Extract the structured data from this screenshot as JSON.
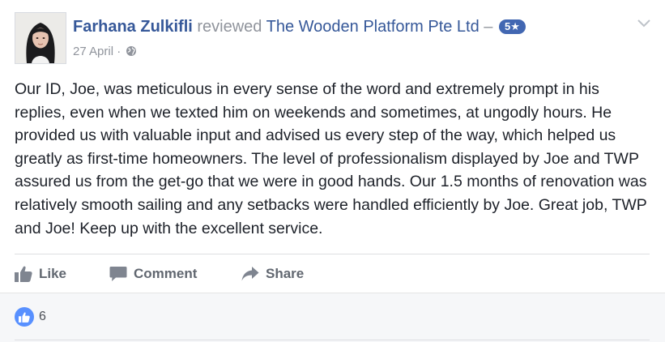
{
  "post": {
    "author": "Farhana Zulkifli",
    "verb": "reviewed",
    "page_name": "The Wooden Platform Pte Ltd",
    "dash": "–",
    "rating": "5★",
    "date": "27 April",
    "date_separator": "·",
    "privacy_icon": "globe-icon",
    "review_text": "Our ID, Joe, was meticulous in every sense of the word and extremely prompt in his replies, even when we texted him on weekends and sometimes, at ungodly hours. He provided us with valuable input and advised us every step of the way, which helped us greatly as first-time homeowners. The level of professionalism displayed by Joe and TWP assured us from the get-go that we were in good hands. Our 1.5 months of renovation was relatively smooth sailing and any setbacks were handled efficiently by Joe. Great job, TWP and Joe! Keep up with the excellent service."
  },
  "actions": {
    "like_label": "Like",
    "comment_label": "Comment",
    "share_label": "Share"
  },
  "reactions": {
    "count": "6",
    "icon": "thumbs-up-icon"
  },
  "colors": {
    "link_blue": "#365899",
    "muted_gray": "#90949c",
    "badge_blue": "#4267b2",
    "action_gray": "#616770",
    "like_bubble": "#5890ff"
  }
}
